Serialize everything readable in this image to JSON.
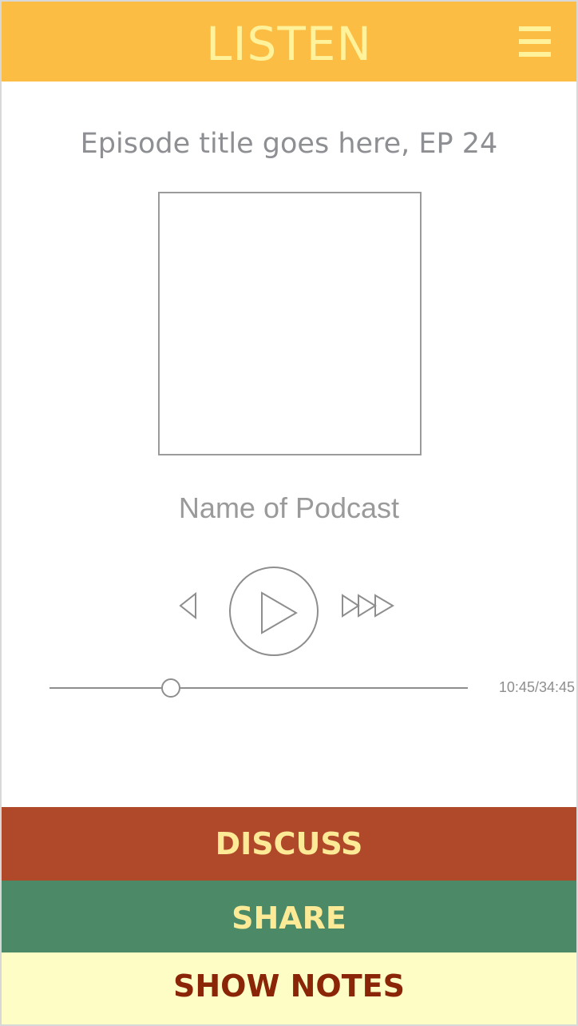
{
  "header": {
    "title": "LISTEN",
    "menu_icon": "hamburger-menu-icon",
    "background": "#fcbd45",
    "text_color": "#fff29a"
  },
  "episode": {
    "title": "Episode title goes here, EP 24"
  },
  "podcast": {
    "name": "Name of Podcast"
  },
  "player": {
    "controls": {
      "previous_icon": "previous-icon",
      "play_icon": "play-icon",
      "fast_forward_icon": "fast-forward-icon"
    },
    "elapsed": "10:45",
    "duration": "34:45",
    "time_readout": "10:45/34:45",
    "progress_fraction": 0.29
  },
  "actions": {
    "discuss": {
      "label": "DISCUSS",
      "background": "#b0482a",
      "text_color": "#fdea97"
    },
    "share": {
      "label": "SHARE",
      "background": "#4c8a67",
      "text_color": "#fdea97"
    },
    "show_notes": {
      "label": "SHOW NOTES",
      "background": "#fffdc6",
      "text_color": "#8b2508"
    }
  }
}
